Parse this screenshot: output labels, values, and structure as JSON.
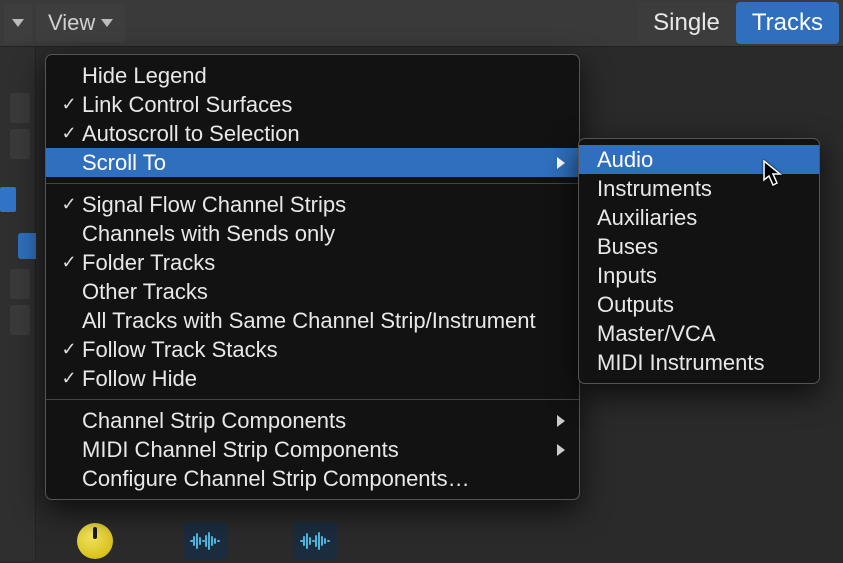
{
  "toolbar": {
    "view_label": "View",
    "segmented": {
      "single": "Single",
      "tracks": "Tracks"
    }
  },
  "menu": {
    "items": [
      {
        "label": "Hide Legend",
        "checked": false
      },
      {
        "label": "Link Control Surfaces",
        "checked": true
      },
      {
        "label": "Autoscroll to Selection",
        "checked": true
      },
      {
        "label": "Scroll To",
        "checked": false,
        "hasSubmenu": true,
        "highlighted": true
      }
    ],
    "items2": [
      {
        "label": "Signal Flow Channel Strips",
        "checked": true
      },
      {
        "label": "Channels with Sends only",
        "checked": false
      },
      {
        "label": "Folder Tracks",
        "checked": true
      },
      {
        "label": "Other Tracks",
        "checked": false
      },
      {
        "label": "All Tracks with Same Channel Strip/Instrument",
        "checked": false
      },
      {
        "label": "Follow Track Stacks",
        "checked": true
      },
      {
        "label": "Follow Hide",
        "checked": true
      }
    ],
    "items3": [
      {
        "label": "Channel Strip Components",
        "hasSubmenu": true
      },
      {
        "label": "MIDI Channel Strip Components",
        "hasSubmenu": true
      },
      {
        "label": "Configure Channel Strip Components…"
      }
    ]
  },
  "submenu": {
    "items": [
      {
        "label": "Audio",
        "highlighted": true
      },
      {
        "label": "Instruments"
      },
      {
        "label": "Auxiliaries"
      },
      {
        "label": "Buses"
      },
      {
        "label": "Inputs"
      },
      {
        "label": "Outputs"
      },
      {
        "label": "Master/VCA"
      },
      {
        "label": "MIDI Instruments"
      }
    ]
  }
}
